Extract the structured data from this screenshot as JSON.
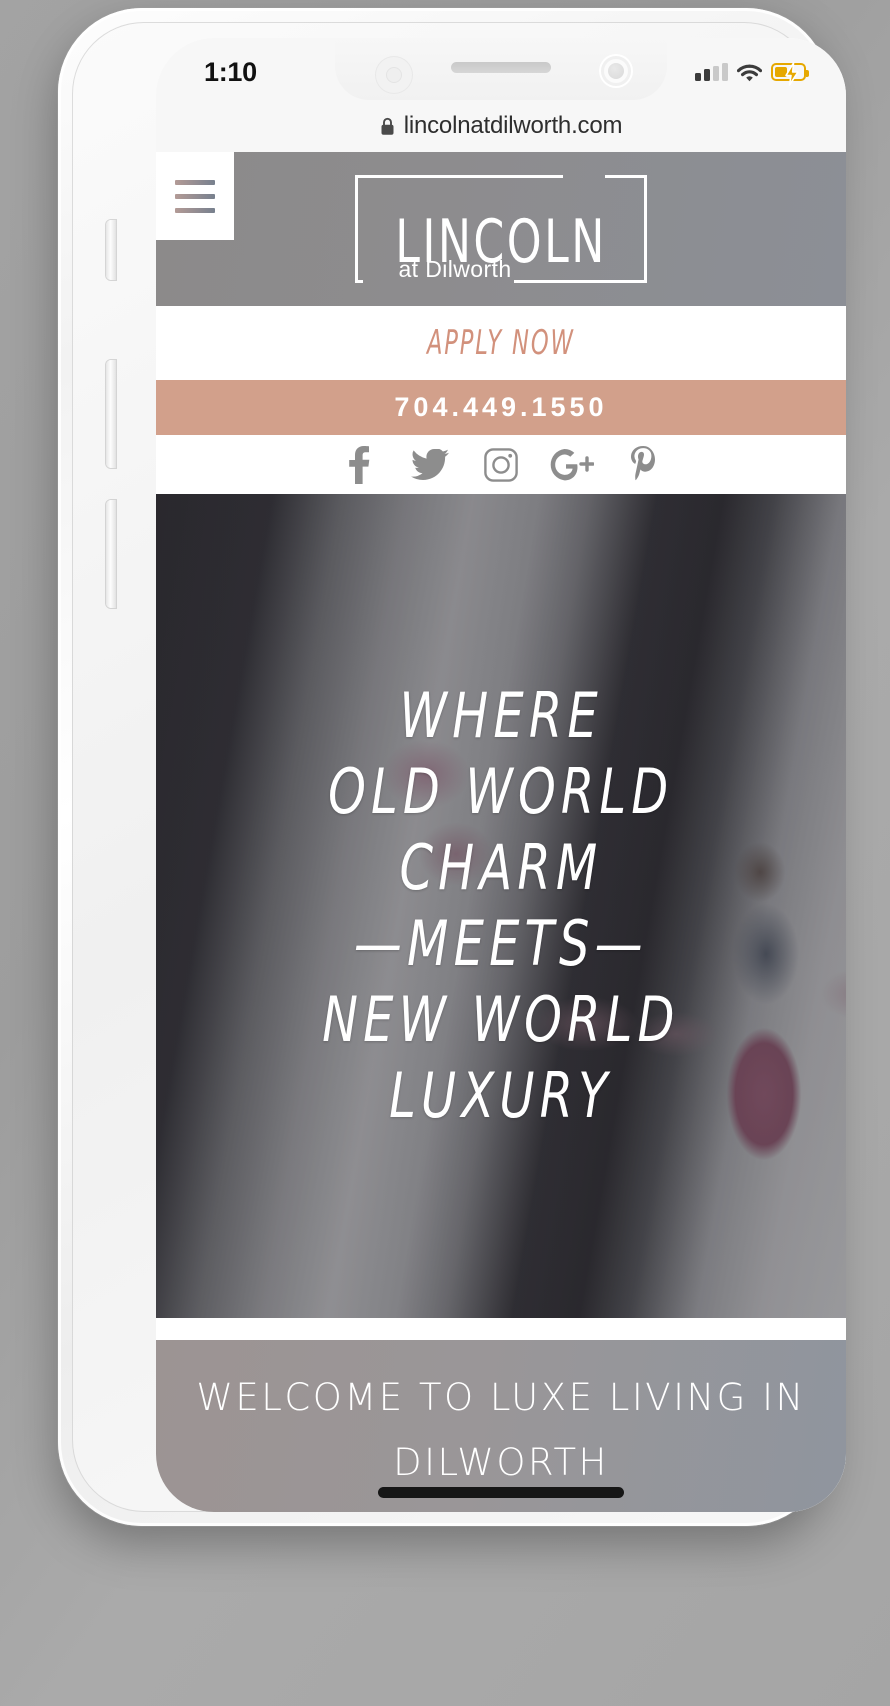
{
  "status_bar": {
    "time": "1:10",
    "signal_icon": "cellular-signal-icon",
    "wifi_icon": "wifi-icon",
    "battery_icon": "battery-charging-icon"
  },
  "browser": {
    "lock_icon": "lock-icon",
    "url": "lincolnatdilworth.com"
  },
  "site_header": {
    "menu_icon": "hamburger-menu-icon",
    "logo_word": "LINCOLN",
    "logo_sub": "at Dilworth"
  },
  "apply": {
    "label": "APPLY NOW",
    "color": "#d2917c"
  },
  "phone": {
    "number": "704.449.1550",
    "band_color": "#d2a08b",
    "text_color": "#ffffff"
  },
  "social": {
    "items": [
      {
        "name": "facebook-icon",
        "label": "Facebook"
      },
      {
        "name": "twitter-icon",
        "label": "Twitter"
      },
      {
        "name": "instagram-icon",
        "label": "Instagram"
      },
      {
        "name": "google-plus-icon",
        "label": "Google Plus"
      },
      {
        "name": "pinterest-icon",
        "label": "Pinterest"
      }
    ],
    "color": "#8d8d8d"
  },
  "hero": {
    "lines": [
      "WHERE",
      "OLD WORLD",
      "CHARM",
      "—MEETS—",
      "NEW WORLD",
      "LUXURY"
    ],
    "text_color": "#ffffff"
  },
  "welcome": {
    "line1": "WELCOME TO LUXE LIVING IN",
    "line2": "DILWORTH",
    "bg_color": "#9a9698",
    "text_color": "#ffffff"
  },
  "device": {
    "home_indicator": "home-indicator-bar",
    "buttons": [
      "silent-switch",
      "volume-up-button",
      "volume-down-button",
      "power-button"
    ]
  }
}
